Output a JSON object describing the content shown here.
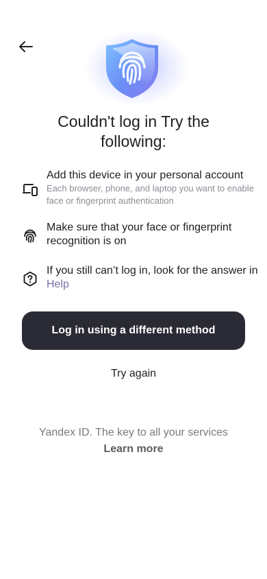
{
  "header": {
    "back_icon": "arrow-left-icon"
  },
  "hero": {
    "icon": "shield-fingerprint-icon"
  },
  "title": "Couldn't log in Try the following:",
  "tips": [
    {
      "icon": "device-icon",
      "main": "Add this device in your personal account",
      "sub": "Each browser, phone, and laptop you want to enable face or fingerprint authentication"
    },
    {
      "icon": "fingerprint-icon",
      "main": "Make sure that your face or fingerprint recognition is on"
    },
    {
      "icon": "help-hexagon-icon",
      "main_prefix": "If you still can’t log in, look for the answer in ",
      "link": "Help"
    }
  ],
  "buttons": {
    "primary": "Log in using a different method",
    "secondary": "Try again"
  },
  "footer": {
    "text": "Yandex ID. The key to all your services",
    "link": "Learn more"
  },
  "colors": {
    "primary_button": "#2a2a35",
    "link": "#7b6fa8",
    "muted": "#8c8c96"
  }
}
